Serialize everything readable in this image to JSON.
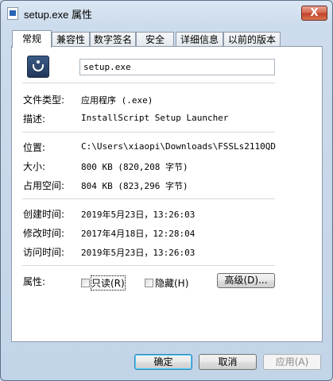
{
  "window": {
    "title": "setup.exe 属性",
    "close_glyph": "X"
  },
  "tabs": [
    {
      "label": "常规",
      "active": true
    },
    {
      "label": "兼容性",
      "active": false
    },
    {
      "label": "数字签名",
      "active": false
    },
    {
      "label": "安全",
      "active": false
    },
    {
      "label": "详细信息",
      "active": false
    },
    {
      "label": "以前的版本",
      "active": false
    }
  ],
  "general": {
    "file_name": "setup.exe",
    "file_type_label": "文件类型:",
    "file_type_value": "应用程序 (.exe)",
    "description_label": "描述:",
    "description_value": "InstallScript Setup Launcher",
    "location_label": "位置:",
    "location_value": "C:\\Users\\xiaopi\\Downloads\\FSSLs2110QD",
    "size_label": "大小:",
    "size_value": "800 KB (820,208 字节)",
    "size_on_disk_label": "占用空间:",
    "size_on_disk_value": "804 KB (823,296 字节)",
    "created_label": "创建时间:",
    "created_value": "2019年5月23日，13:26:03",
    "modified_label": "修改时间:",
    "modified_value": "2017年4月18日，12:28:04",
    "accessed_label": "访问时间:",
    "accessed_value": "2019年5月23日，13:26:03",
    "attributes_label": "属性:",
    "readonly_label": "只读(R)",
    "readonly_checked": false,
    "hidden_label": "隐藏(H)",
    "hidden_checked": false,
    "advanced_label": "高级(D)..."
  },
  "footer": {
    "ok_label": "确定",
    "cancel_label": "取消",
    "apply_label": "应用(A)",
    "apply_enabled": false
  },
  "colors": {
    "frame": "#c9d9ea",
    "close_button": "#c2412a",
    "default_button_border": "#3c7fb1"
  }
}
